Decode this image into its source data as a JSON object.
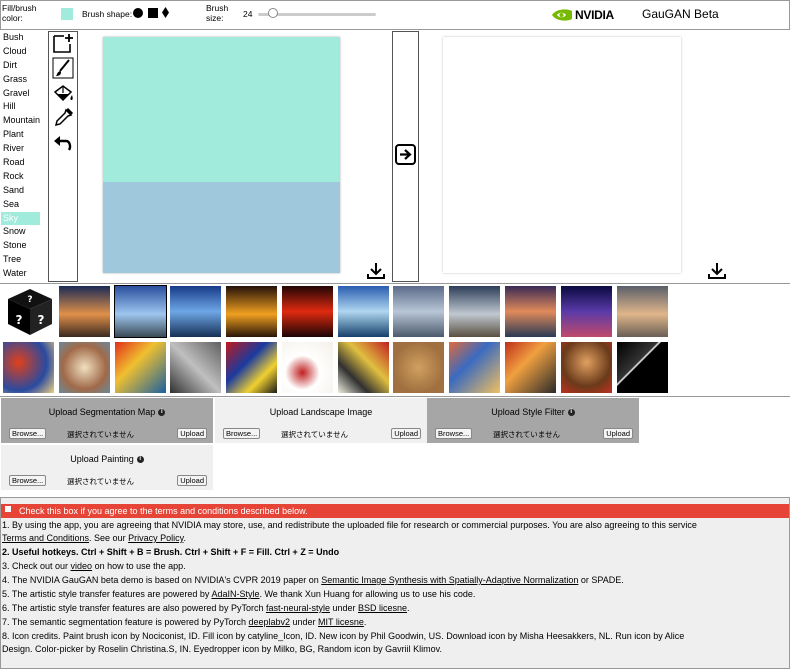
{
  "toolbar": {
    "fill_label": "Fill/brush color:",
    "fill_color": "#a0ebdc",
    "brush_shape_label": "Brush shape:",
    "brush_shapes": [
      "circle-icon",
      "square-icon",
      "diamond-icon"
    ],
    "brush_size_label": "Brush size:",
    "brush_size": "24",
    "brush_size_slider_fraction": 0.12,
    "logo_text": "NVIDIA",
    "app_title": "GauGAN Beta"
  },
  "classes": [
    {
      "label": "Bush"
    },
    {
      "label": "Cloud"
    },
    {
      "label": "Dirt"
    },
    {
      "label": "Grass"
    },
    {
      "label": "Gravel"
    },
    {
      "label": "Hill"
    },
    {
      "label": "Mountain"
    },
    {
      "label": "Plant"
    },
    {
      "label": "River"
    },
    {
      "label": "Road"
    },
    {
      "label": "Rock"
    },
    {
      "label": "Sand"
    },
    {
      "label": "Sea"
    },
    {
      "label": "Sky"
    },
    {
      "label": "Snow"
    },
    {
      "label": "Stone"
    },
    {
      "label": "Tree"
    },
    {
      "label": "Water"
    }
  ],
  "selected_class": "Sky",
  "tools": [
    "new-icon",
    "paint-brush-icon",
    "fill-icon",
    "eyedropper-icon",
    "undo-icon"
  ],
  "colors": {
    "sky": "#a0ebdc",
    "sea": "#a0c8dc",
    "terms_bar": "#e64437"
  },
  "landscape_gallery": [
    "random-dice-icon",
    "landscape-1",
    "landscape-2",
    "landscape-3",
    "landscape-4",
    "landscape-5",
    "landscape-6",
    "landscape-7",
    "landscape-8",
    "landscape-9",
    "landscape-10",
    "landscape-11"
  ],
  "style_gallery": [
    "style-1",
    "style-2",
    "style-3",
    "style-4",
    "style-5",
    "style-6",
    "style-7",
    "style-8",
    "style-9",
    "style-10",
    "style-11",
    "style-12"
  ],
  "uploads": {
    "segmentation": {
      "title": "Upload Segmentation Map",
      "browse": "Browse...",
      "no_file": "選択されていません",
      "upload": "Upload"
    },
    "landscape": {
      "title": "Upload Landscape Image",
      "browse": "Browse...",
      "no_file": "選択されていません",
      "upload": "Upload"
    },
    "style": {
      "title": "Upload Style Filter",
      "browse": "Browse...",
      "no_file": "選択されていません",
      "upload": "Upload"
    },
    "painting": {
      "title": "Upload Painting",
      "browse": "Browse...",
      "no_file": "選択されていません",
      "upload": "Upload"
    }
  },
  "terms": {
    "checkbox_label": "Check this box if you agree to the terms and conditions described below.",
    "l1_a": "1. By using the app, you are agreeing that NVIDIA may store, use, and redistribute the uploaded file for research or commercial purposes. You are also agreeing to this service",
    "l1_link": "Terms and Conditions",
    "l1_b": ". See our ",
    "l1_link2": "Privacy Policy",
    "l1_c": ".",
    "l2": "2. Useful hotkeys. Ctrl + Shift + B = Brush. Ctrl + Shift + F = Fill. Ctrl + Z = Undo",
    "l3_a": "3. Check out our ",
    "l3_link": "video",
    "l3_b": " on how to use the app.",
    "l4_a": "4. The NVIDIA GauGAN beta demo is based on NVIDIA's CVPR 2019 paper on ",
    "l4_link": "Semantic Image Synthesis with Spatially-Adaptive Normalization",
    "l4_b": " or SPADE.",
    "l5_a": "5. The artistic style transfer features are powered by ",
    "l5_link": "AdaIN-Style",
    "l5_b": ". We thank Xun Huang for allowing us to use his code.",
    "l6_a": "6. The artistic style transfer features are also powered by PyTorch ",
    "l6_link": "fast-neural-style",
    "l6_b": " under ",
    "l6_link2": "BSD licesne",
    "l6_c": ".",
    "l7_a": "7. The semantic segmentation feature is powered by PyTorch ",
    "l7_link": "deeplabv2",
    "l7_b": " under ",
    "l7_link2": "MIT licesne",
    "l7_c": ".",
    "l8": "8. Icon credits. Paint brush icon by Nociconist, ID. Fill icon by catyline_Icon, ID. New icon by Phil Goodwin, US. Download icon by Misha Heesakkers, NL. Run icon by Alice",
    "l9": "Design. Color-picker by Roselin Christina.S, IN. Eyedropper icon by Milko, BG, Random icon by Gavriil Klimov."
  }
}
